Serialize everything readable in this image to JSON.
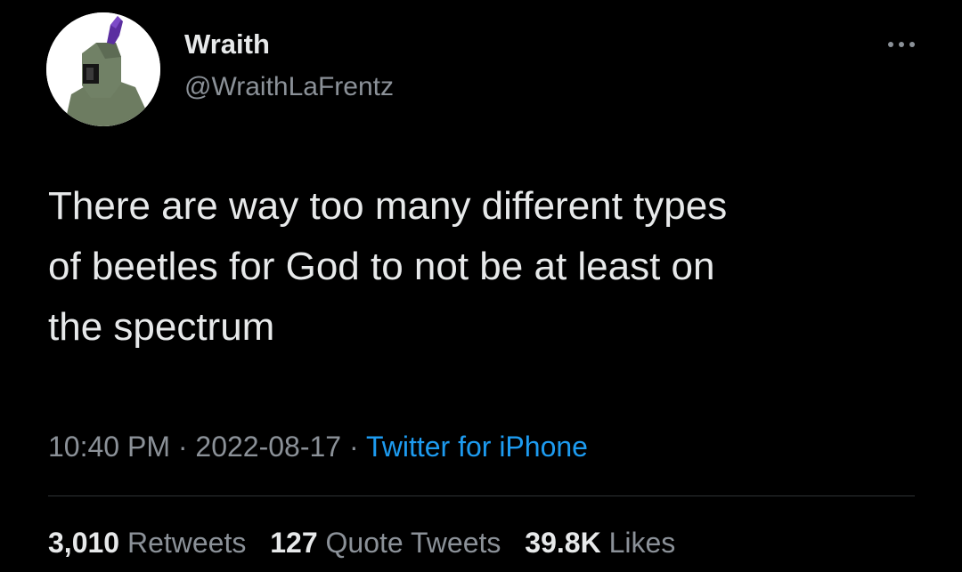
{
  "user": {
    "display_name": "Wraith",
    "handle": "@WraithLaFrentz",
    "avatar_icon": "armored-knight-avatar"
  },
  "menu": {
    "icon": "more-options-icon",
    "glyph": "···"
  },
  "tweet": {
    "text": "There are way too many different types\nof beetles for God to not be at least on\nthe spectrum"
  },
  "meta": {
    "time": "10:40 PM",
    "separator": "·",
    "date": "2022-08-17",
    "source": "Twitter for iPhone"
  },
  "stats": {
    "retweets_count": "3,010",
    "retweets_label": "Retweets",
    "quotes_count": "127",
    "quotes_label": "Quote Tweets",
    "likes_count": "39.8K",
    "likes_label": "Likes"
  },
  "colors": {
    "background": "#000000",
    "text_primary": "#e7e9ea",
    "text_secondary": "#8b9198",
    "link": "#1d9bf0",
    "divider": "#2f3336"
  }
}
